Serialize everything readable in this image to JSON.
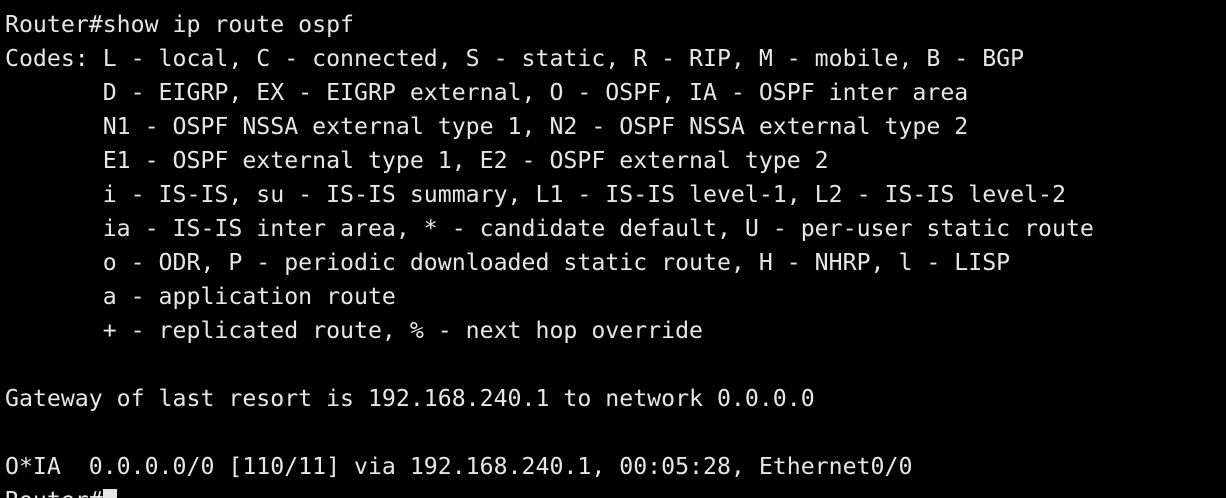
{
  "terminal": {
    "clipped_top_line": "Router#show ip route ospf  (previous output, clipped)",
    "prompt_command": "Router#show ip route ospf",
    "codes": [
      "Codes: L - local, C - connected, S - static, R - RIP, M - mobile, B - BGP",
      "       D - EIGRP, EX - EIGRP external, O - OSPF, IA - OSPF inter area",
      "       N1 - OSPF NSSA external type 1, N2 - OSPF NSSA external type 2",
      "       E1 - OSPF external type 1, E2 - OSPF external type 2",
      "       i - IS-IS, su - IS-IS summary, L1 - IS-IS level-1, L2 - IS-IS level-2",
      "       ia - IS-IS inter area, * - candidate default, U - per-user static route",
      "       o - ODR, P - periodic downloaded static route, H - NHRP, l - LISP",
      "       a - application route",
      "       + - replicated route, % - next hop override"
    ],
    "gateway_line": "Gateway of last resort is 192.168.240.1 to network 0.0.0.0",
    "route_line": "O*IA  0.0.0.0/0 [110/11] via 192.168.240.1, 00:05:28, Ethernet0/0",
    "final_prompt": "Router#"
  }
}
